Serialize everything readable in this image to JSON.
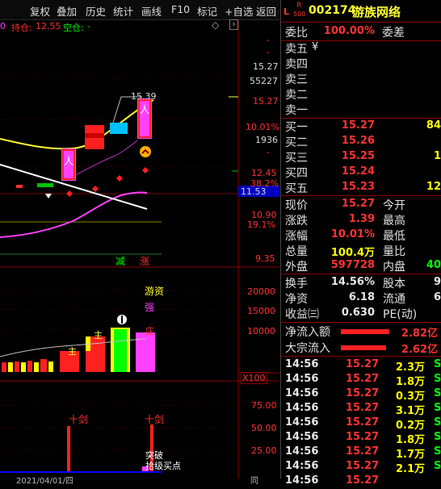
{
  "menu": [
    "复权",
    "叠加",
    "历史",
    "统计",
    "画线",
    "F10",
    "标记",
    "+自选",
    "返回"
  ],
  "top_info": {
    "hold_label": "持仓:",
    "hold_value": "12.55",
    "empty_label": "空仓:",
    "empty_value": "-",
    "lead": "0"
  },
  "right_axis_main": [
    "15.27",
    "55227",
    "15.27",
    "10.01%",
    "1936",
    "12.45",
    "38.2%",
    "11.53",
    "10.90",
    "19.1%",
    "9.35"
  ],
  "axis_dashes": [
    "-",
    "-",
    "-"
  ],
  "price_marker": "15.39",
  "bottom_labels": {
    "jian": "减",
    "zhang": "涨"
  },
  "vol_axis": [
    "20000",
    "15000",
    "10000",
    "X100"
  ],
  "vol_labels": {
    "youzi": "游资",
    "qiang": "强",
    "zhu": "主",
    "zhuang": "庄",
    "bar_mark": "Ф"
  },
  "ind_axis": [
    "75.00",
    "50.00",
    "25.00"
  ],
  "ind_labels": {
    "shijian1": "十剑",
    "shijian2": "十剑",
    "tupo": "突破",
    "maidian": "买点",
    "jiejin": "拾级"
  },
  "bottom_date": "2021/04/01/四",
  "bottom_misc": "同",
  "quote": {
    "badge_l": "L",
    "badge_r": "R",
    "badge_500": "500",
    "code": "002174",
    "name": "游族网络",
    "weibi_label": "委比",
    "weibi_value": "100.00%",
    "weicha_label": "委差",
    "weicha_value": "",
    "sell": [
      {
        "label": "卖五",
        "price": "¥",
        "vol": ""
      },
      {
        "label": "卖四",
        "price": "",
        "vol": ""
      },
      {
        "label": "卖三",
        "price": "",
        "vol": ""
      },
      {
        "label": "卖二",
        "price": "",
        "vol": ""
      },
      {
        "label": "卖一",
        "price": "",
        "vol": ""
      }
    ],
    "buy": [
      {
        "label": "买一",
        "price": "15.27",
        "vol": "84"
      },
      {
        "label": "买二",
        "price": "15.26",
        "vol": ""
      },
      {
        "label": "买三",
        "price": "15.25",
        "vol": "1"
      },
      {
        "label": "买四",
        "price": "15.24",
        "vol": ""
      },
      {
        "label": "买五",
        "price": "15.23",
        "vol": "12"
      }
    ],
    "stats_left": [
      {
        "label": "现价",
        "value": "15.27"
      },
      {
        "label": "涨跌",
        "value": "1.39"
      },
      {
        "label": "涨幅",
        "value": "10.01%"
      },
      {
        "label": "总量",
        "value": "100.4万"
      },
      {
        "label": "外盘",
        "value": "597728"
      }
    ],
    "stats_right": [
      {
        "label": "今开",
        "value": ""
      },
      {
        "label": "最高",
        "value": ""
      },
      {
        "label": "最低",
        "value": ""
      },
      {
        "label": "量比",
        "value": ""
      },
      {
        "label": "内盘",
        "value": "40"
      }
    ],
    "stats2_left": [
      {
        "label": "换手",
        "value": "14.56%"
      },
      {
        "label": "净资",
        "value": "6.18"
      },
      {
        "label": "收益㈢",
        "value": "0.630"
      }
    ],
    "stats2_right": [
      {
        "label": "股本",
        "value": "9"
      },
      {
        "label": "流通",
        "value": "6"
      },
      {
        "label": "PE(动)",
        "value": ""
      }
    ],
    "netflow": {
      "label": "净流入额",
      "value": "2.82亿"
    },
    "blockflow": {
      "label": "大宗流入",
      "value": "2.62亿"
    },
    "ticks": [
      {
        "time": "14:56",
        "price": "15.27",
        "vol": "2.3万",
        "flag": "S"
      },
      {
        "time": "14:56",
        "price": "15.27",
        "vol": "1.8万",
        "flag": "S"
      },
      {
        "time": "14:56",
        "price": "15.27",
        "vol": "0.3万",
        "flag": "S"
      },
      {
        "time": "14:56",
        "price": "15.27",
        "vol": "3.1万",
        "flag": "S"
      },
      {
        "time": "14:56",
        "price": "15.27",
        "vol": "0.2万",
        "flag": "S"
      },
      {
        "time": "14:56",
        "price": "15.27",
        "vol": "1.8万",
        "flag": "S"
      },
      {
        "time": "14:56",
        "price": "15.27",
        "vol": "1.7万",
        "flag": "S"
      },
      {
        "time": "14:56",
        "price": "15.27",
        "vol": "2.1万",
        "flag": "S"
      },
      {
        "time": "14:56",
        "price": "15.27",
        "vol": "",
        "flag": ""
      }
    ]
  }
}
